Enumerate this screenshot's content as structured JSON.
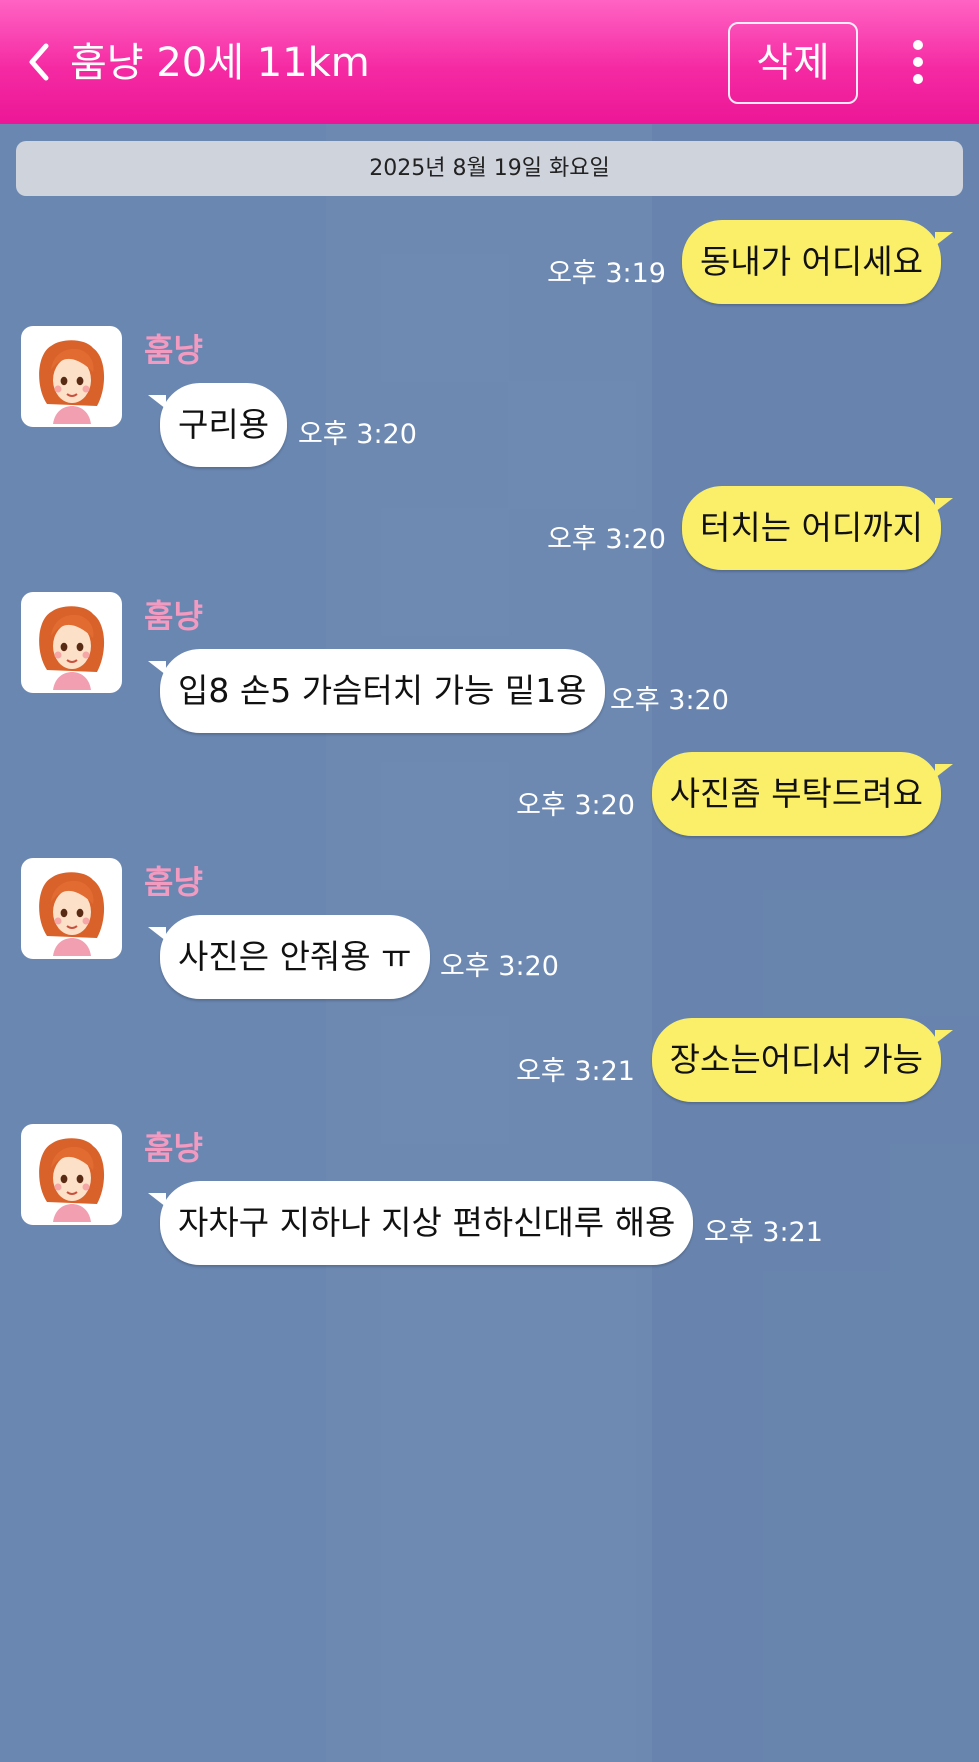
{
  "header": {
    "title": "훔냥 20세 11km",
    "delete_label": "삭제"
  },
  "date_label": "2025년 8월 19일 화요일",
  "colors": {
    "header_top": "#ff63c3",
    "header_bottom": "#ec1696",
    "chat_background": "#6a87b1",
    "outgoing_bubble": "#fbef6a",
    "incoming_bubble": "#ffffff",
    "sender_name": "#f39ac1"
  },
  "messages": [
    {
      "direction": "out",
      "text": "동내가 어디세요",
      "time": "오후 3:19"
    },
    {
      "direction": "in",
      "sender": "훔냥",
      "text": "구리용",
      "time": "오후 3:20"
    },
    {
      "direction": "out",
      "text": "터치는 어디까지",
      "time": "오후 3:20"
    },
    {
      "direction": "in",
      "sender": "훔냥",
      "text": "입8 손5 가슴터치 가능 밑1용",
      "time": "오후 3:20"
    },
    {
      "direction": "out",
      "text": "사진좀 부탁드려요",
      "time": "오후 3:20"
    },
    {
      "direction": "in",
      "sender": "훔냥",
      "text": "사진은 안줘용 ㅠ",
      "time": "오후 3:20"
    },
    {
      "direction": "out",
      "text": "장소는어디서 가능",
      "time": "오후 3:21"
    },
    {
      "direction": "in",
      "sender": "훔냥",
      "text": "자차구 지하나 지상 편하신대루 해용",
      "time": "오후 3:21"
    }
  ],
  "icons": {
    "back": "chevron-left-icon",
    "more": "more-vertical-icon",
    "avatar": "cartoon-girl-avatar"
  }
}
